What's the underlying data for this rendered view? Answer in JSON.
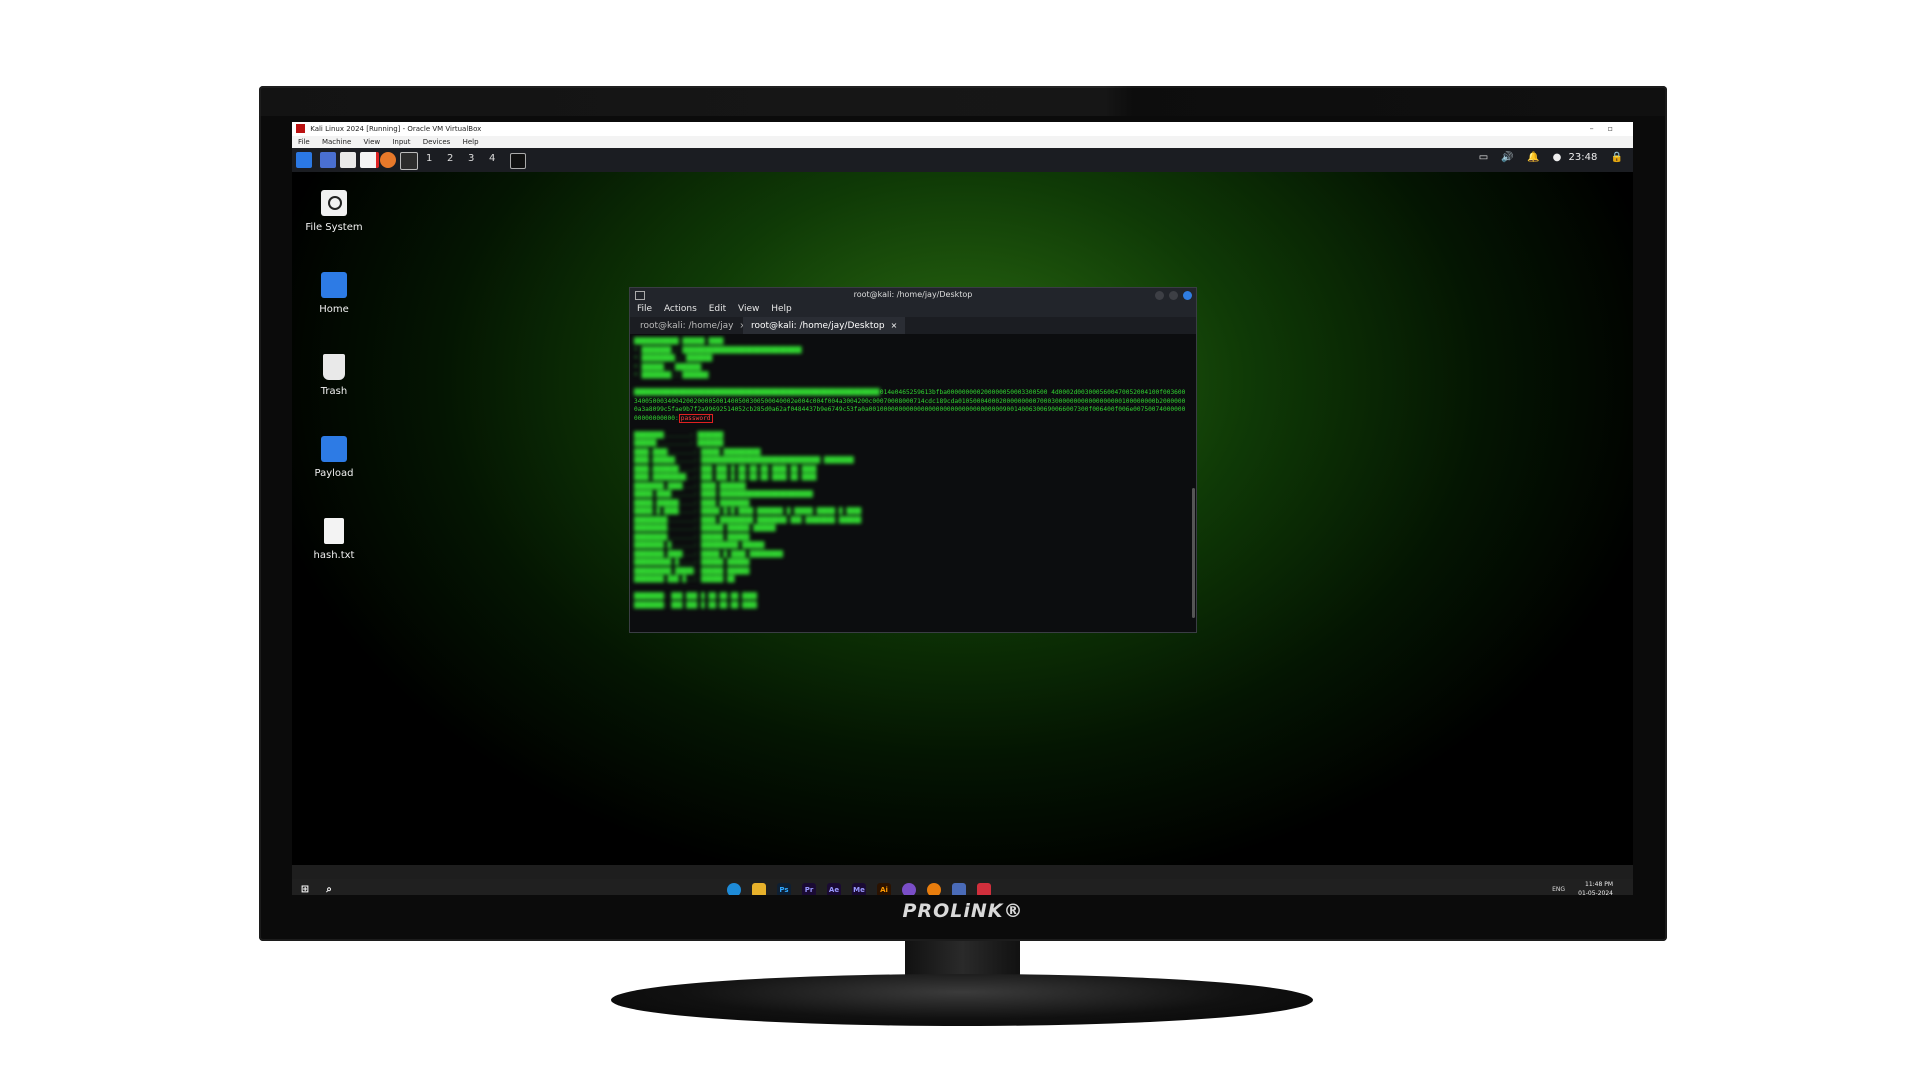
{
  "monitor": {
    "brand": "PROLiNK®"
  },
  "vbox": {
    "title": "Kali Linux 2024 [Running] - Oracle VM VirtualBox",
    "menu": [
      "File",
      "Machine",
      "View",
      "Input",
      "Devices",
      "Help"
    ]
  },
  "kali_panel": {
    "workspaces": [
      "1",
      "2",
      "3",
      "4"
    ],
    "clock": "23:48"
  },
  "desktop_icons": [
    {
      "label": "File System",
      "icon": "drive-icon"
    },
    {
      "label": "Home",
      "icon": "home-folder-icon"
    },
    {
      "label": "Trash",
      "icon": "trash-icon"
    },
    {
      "label": "Payload",
      "icon": "folder-icon"
    },
    {
      "label": "hash.txt",
      "icon": "locked-file-icon"
    }
  ],
  "terminal": {
    "title": "root@kali: /home/jay/Desktop",
    "menu": [
      "File",
      "Actions",
      "Edit",
      "View",
      "Help"
    ],
    "tabs": [
      {
        "label": "root@kali: /home/jay",
        "active": false
      },
      {
        "label": "root@kali: /home/jay/Desktop",
        "active": true
      }
    ],
    "hash_text": "014e0465259613bfba000000000200000050003300500 4d0002d0030005600470052004100f0036003400500034004200200005001400500300500040002e004c004f004a3004200c00070008000714cdc189cda01050004000200000000070003000000000000000000100000000b20000000a3a8099c5fae9b7f2a99692514052cb285d0a62af0484437b9e6749c53fa0a00100000000000000000000000000000000090014006300690066007300f006400f006e0075007400000000000000000",
    "highlight": "password"
  },
  "windows_taskbar": {
    "lang": "ENG",
    "time": "11:48 PM",
    "date": "01-05-2024"
  }
}
